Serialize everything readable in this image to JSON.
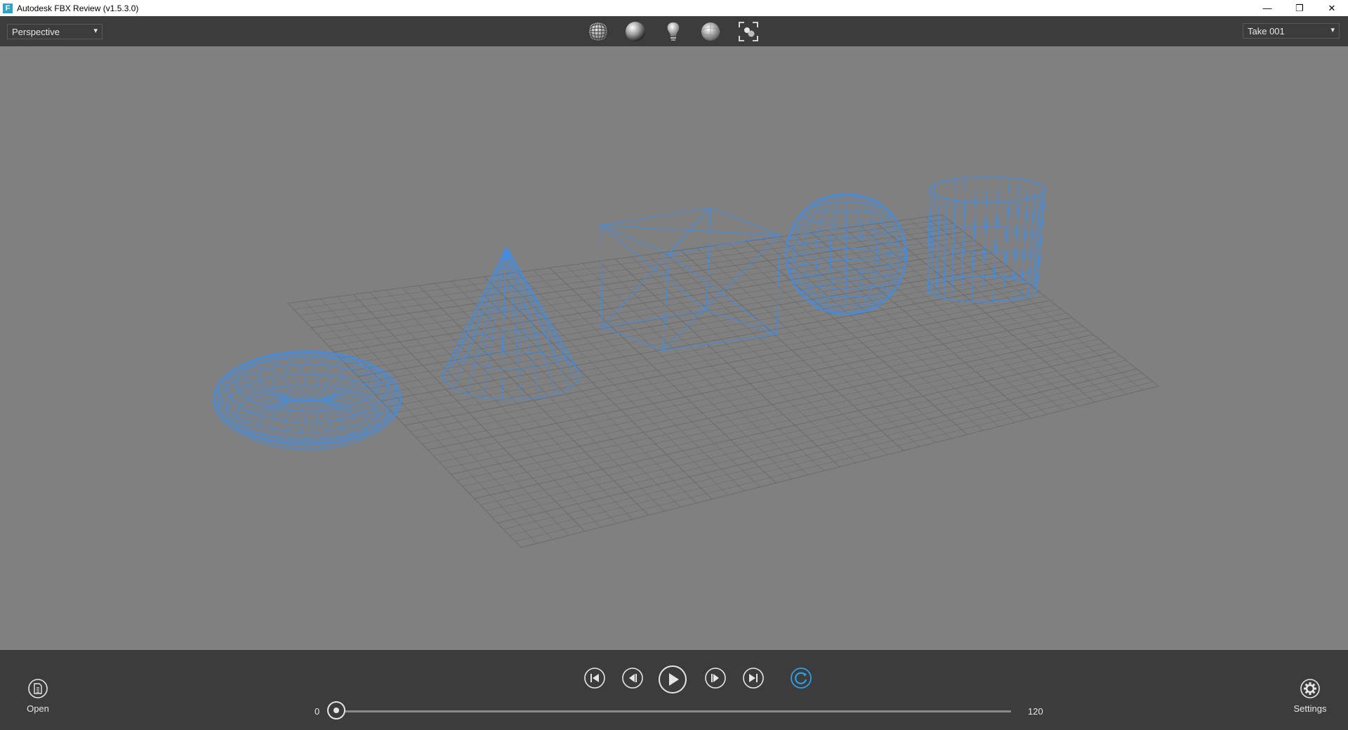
{
  "window": {
    "title": "Autodesk FBX Review (v1.5.3.0)",
    "app_icon_letter": "F",
    "minimize_glyph": "—",
    "restore_glyph": "❐",
    "close_glyph": "✕"
  },
  "toolbar": {
    "camera_dropdown": "Perspective",
    "take_dropdown": "Take 001",
    "view_modes": [
      "wireframe-icon",
      "shaded-icon",
      "lighting-icon",
      "textured-icon",
      "frame-all-icon"
    ]
  },
  "scene": {
    "objects": [
      "torus",
      "cone",
      "cube",
      "sphere",
      "cylinder"
    ],
    "wire_color": "#3d8ee8",
    "grid_color": "#6b6b6b"
  },
  "bottom": {
    "open_label": "Open",
    "settings_label": "Settings",
    "time_start": "0",
    "time_end": "120",
    "current_frame": 0,
    "loop_color": "#2ea0e6"
  }
}
